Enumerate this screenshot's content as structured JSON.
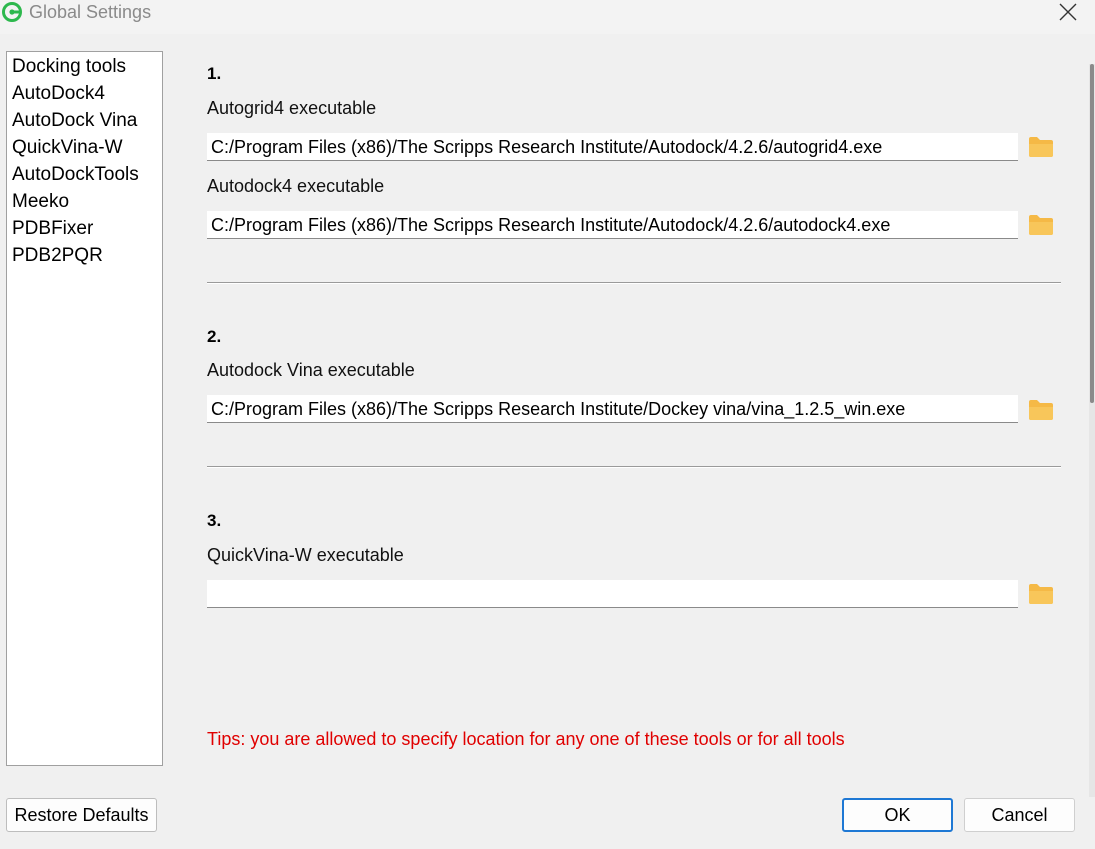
{
  "window": {
    "title": "Global Settings",
    "accent_color": "#2db84d"
  },
  "sidebar": {
    "items": [
      {
        "label": "Docking tools"
      },
      {
        "label": "AutoDock4"
      },
      {
        "label": "AutoDock Vina"
      },
      {
        "label": "QuickVina-W"
      },
      {
        "label": "AutoDockTools"
      },
      {
        "label": "Meeko"
      },
      {
        "label": "PDBFixer"
      },
      {
        "label": "PDB2PQR"
      }
    ]
  },
  "sections": [
    {
      "number": "1.",
      "fields": [
        {
          "label": "Autogrid4 executable",
          "value": "C:/Program Files (x86)/The Scripps Research Institute/Autodock/4.2.6/autogrid4.exe",
          "icon": "folder-icon"
        },
        {
          "label": "Autodock4 executable",
          "value": "C:/Program Files (x86)/The Scripps Research Institute/Autodock/4.2.6/autodock4.exe",
          "icon": "folder-icon"
        }
      ]
    },
    {
      "number": "2.",
      "fields": [
        {
          "label": "Autodock Vina executable",
          "value": "C:/Program Files (x86)/The Scripps Research Institute/Dockey vina/vina_1.2.5_win.exe",
          "icon": "folder-icon"
        }
      ]
    },
    {
      "number": "3.",
      "fields": [
        {
          "label": "QuickVina-W executable",
          "value": "",
          "icon": "folder-icon"
        }
      ]
    }
  ],
  "tips": {
    "text": "Tips: you are allowed to specify location for any one of these tools or for all tools",
    "color": "#e00000"
  },
  "buttons": {
    "restore_defaults": "Restore Defaults",
    "ok": "OK",
    "cancel": "Cancel"
  },
  "colors": {
    "folder": "#f5b946",
    "ok_border": "#1e78d4"
  }
}
